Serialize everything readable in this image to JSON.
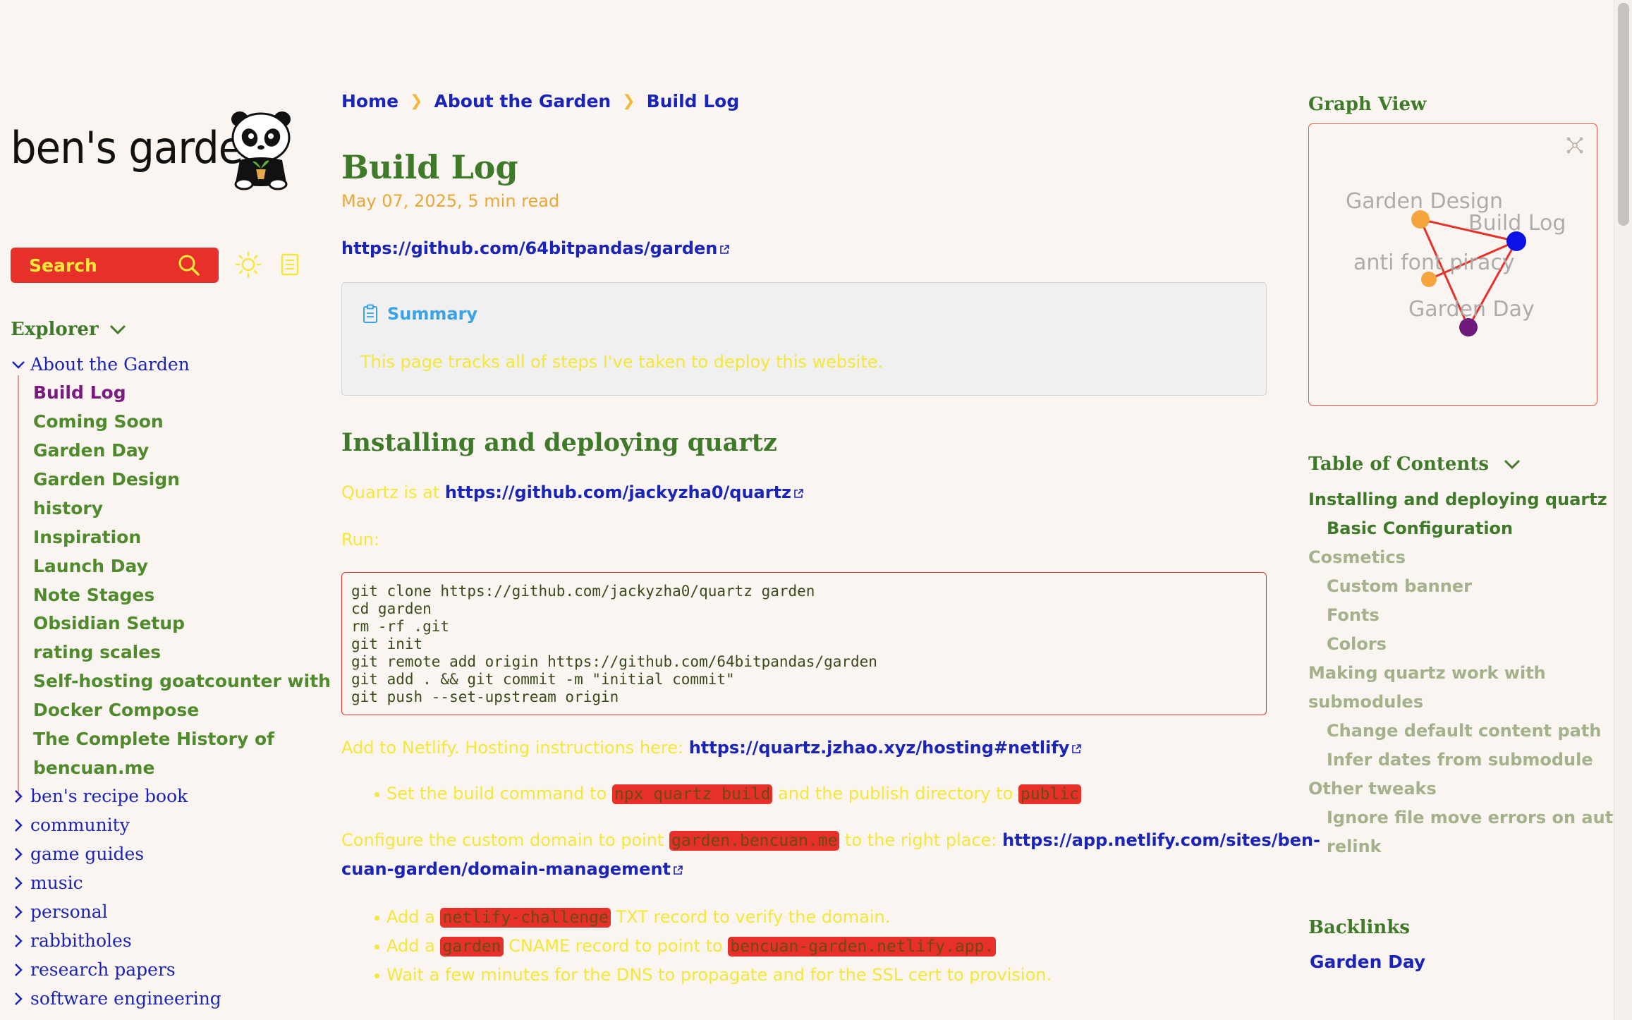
{
  "site": {
    "title": "ben's garden"
  },
  "search": {
    "label": "Search"
  },
  "explorer": {
    "title": "Explorer",
    "open_folder": "About the Garden",
    "children": [
      "Build Log",
      "Coming Soon",
      "Garden Day",
      "Garden Design",
      "history",
      "Inspiration",
      "Launch Day",
      "Note Stages",
      "Obsidian Setup",
      "rating scales",
      "Self-hosting goatcounter with",
      "Docker Compose",
      "The Complete History of",
      "bencuan.me"
    ],
    "active_child": "Build Log",
    "folders": [
      "ben's recipe book",
      "community",
      "game guides",
      "music",
      "personal",
      "rabbitholes",
      "research papers",
      "software engineering"
    ]
  },
  "breadcrumb": [
    "Home",
    "About the Garden",
    "Build Log"
  ],
  "article": {
    "title": "Build Log",
    "date": "May 07, 2025",
    "read_time": "5 min read",
    "repo_link": "https://github.com/64bitpandas/garden",
    "summary_title": "Summary",
    "summary_text": "This page tracks all of steps I've taken to deploy this website.",
    "h2_install": "Installing and deploying quartz",
    "quartz_prefix": "Quartz is at ",
    "quartz_link": "https://github.com/jackyzha0/quartz",
    "run_label": "Run:",
    "code": "git clone https://github.com/jackyzha0/quartz garden\ncd garden\nrm -rf .git\ngit init\ngit remote add origin https://github.com/64bitpandas/garden\ngit add . && git commit -m \"initial commit\"\ngit push --set-upstream origin",
    "netlify_prefix": "Add to Netlify. Hosting instructions here: ",
    "netlify_link": "https://quartz.jzhao.xyz/hosting#netlify",
    "bullet_build_1": "Set the build command to ",
    "bullet_build_code1": "npx quartz build",
    "bullet_build_2": " and the publish directory to ",
    "bullet_build_code2": "public",
    "domain_prefix": "Configure the custom domain to point ",
    "domain_code": "garden.bencuan.me",
    "domain_mid": " to the right place: ",
    "domain_link_1": "https://app.netlify.com/sites/ben-",
    "domain_link_2": "cuan-garden/domain-management",
    "bullets_dns": [
      {
        "pre": "Add a ",
        "code": "netlify-challenge",
        "post": " TXT record to verify the domain."
      },
      {
        "pre": "Add a ",
        "code": "garden",
        "post": " CNAME record to point to ",
        "code2": "bencuan-garden.netlify.app."
      },
      {
        "pre": "Wait a few minutes for the DNS to propagate and for the SSL cert to provision."
      }
    ]
  },
  "graph": {
    "title": "Graph View",
    "nodes": [
      "Garden Design",
      "Build Log",
      "anti font piracy",
      "Garden Day"
    ]
  },
  "toc": {
    "title": "Table of Contents",
    "items": [
      {
        "label": "Installing and deploying quartz",
        "level": 1,
        "state": "current"
      },
      {
        "label": "Basic Configuration",
        "level": 2,
        "state": "current"
      },
      {
        "label": "Cosmetics",
        "level": 1,
        "state": "dim"
      },
      {
        "label": "Custom banner",
        "level": 2,
        "state": "dim"
      },
      {
        "label": "Fonts",
        "level": 2,
        "state": "dim"
      },
      {
        "label": "Colors",
        "level": 2,
        "state": "dim"
      },
      {
        "label": "Making quartz work with",
        "level": 1,
        "state": "dim"
      },
      {
        "label": "submodules",
        "level": 1,
        "state": "dim"
      },
      {
        "label": "Change default content path",
        "level": 2,
        "state": "dim"
      },
      {
        "label": "Infer dates from submodule",
        "level": 2,
        "state": "dim"
      },
      {
        "label": "Other tweaks",
        "level": 1,
        "state": "dim"
      },
      {
        "label": "Ignore file move errors on auto-",
        "level": 2,
        "state": "dim"
      },
      {
        "label": "relink",
        "level": 2,
        "state": "dim"
      }
    ]
  },
  "backlinks": {
    "title": "Backlinks",
    "items": [
      "Garden Day"
    ]
  },
  "colors": {
    "accent_red": "#e8302a",
    "heading_green": "#3f7a2a",
    "link_blue": "#1a24b8",
    "text_yellow": "#f5e73a",
    "background": "#faf5f0"
  }
}
